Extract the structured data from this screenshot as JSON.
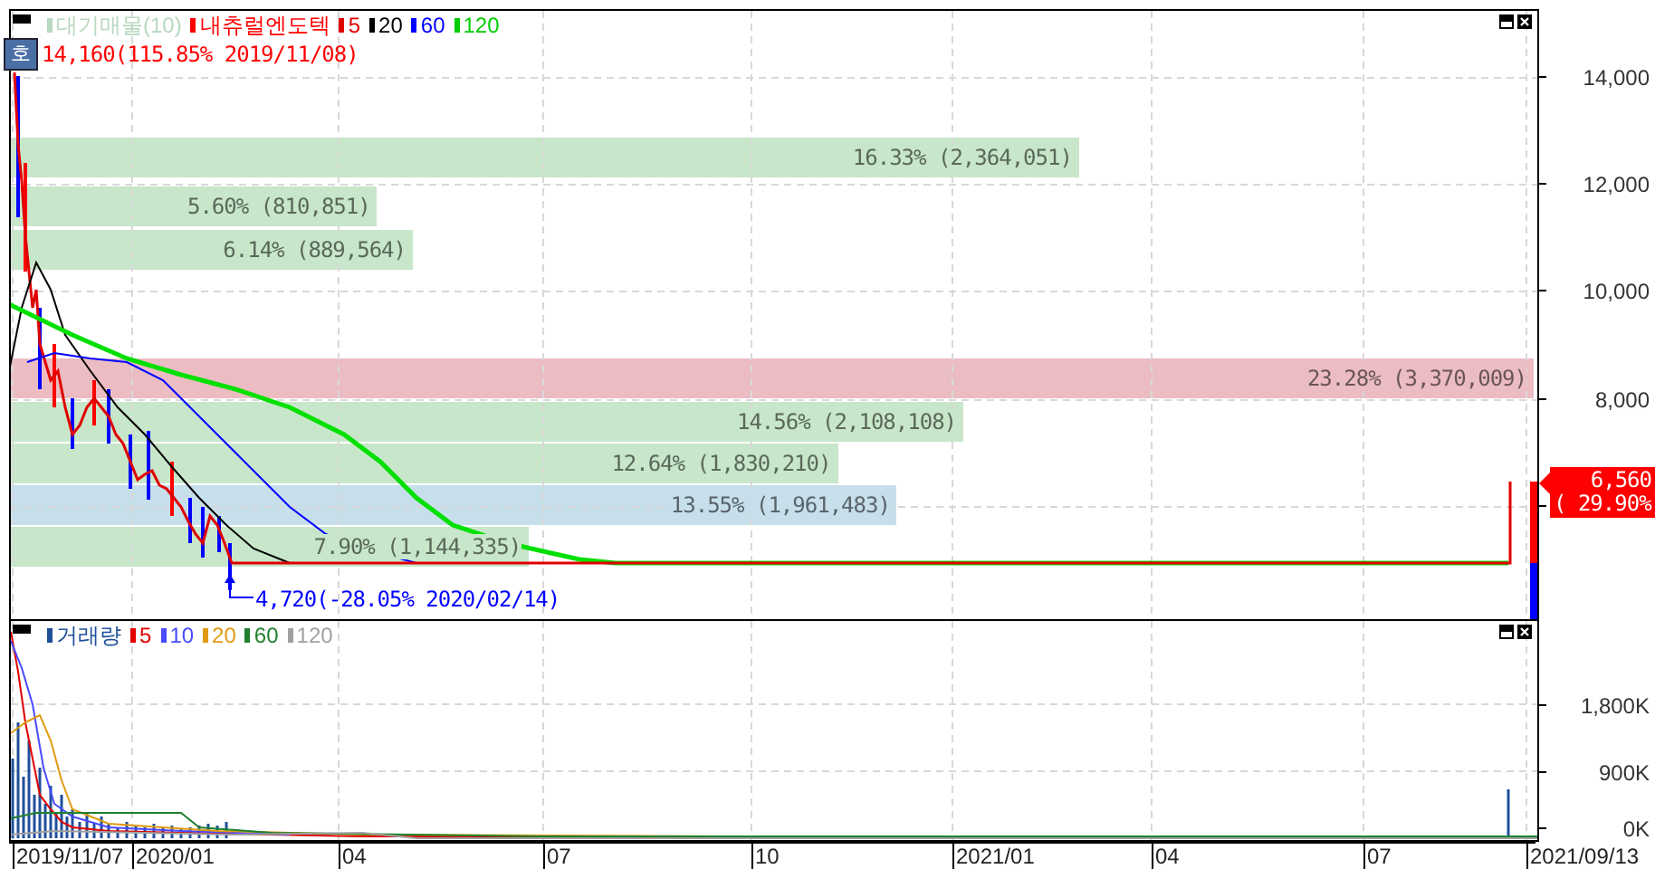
{
  "price_panel": {
    "legend": [
      {
        "label": "대기매물(10)",
        "color": "#b8d8c0"
      },
      {
        "label": "내츄럴엔도텍",
        "color": "#ff0000"
      },
      {
        "label": "5",
        "color": "#e00000"
      },
      {
        "label": "20",
        "color": "#000000"
      },
      {
        "label": "60",
        "color": "#0000ff"
      },
      {
        "label": "120",
        "color": "#00cc00"
      }
    ],
    "badge": "호",
    "high_label": "14,160(115.85% 2019/11/08)",
    "low_label": "4,720(-28.05% 2020/02/14)",
    "volume_profile": [
      {
        "label": "16.33% (2,364,051)",
        "level": 0.7015,
        "color": "#c8e6c9"
      },
      {
        "label": "5.60% (810,851)",
        "level": 0.2406,
        "color": "#c8e6c9"
      },
      {
        "label": "6.14% (889,564)",
        "level": 0.264,
        "color": "#c8e6c9"
      },
      {
        "label": "23.28% (3,370,009)",
        "level": 1,
        "color": "#ebbcc2"
      },
      {
        "label": "14.56% (2,108,108)",
        "level": 0.6255,
        "color": "#c8e6c9"
      },
      {
        "label": "12.64% (1,830,210)",
        "level": 0.5431,
        "color": "#c8e6c9"
      },
      {
        "label": "13.55% (1,961,483)",
        "level": 0.582,
        "color": "#c6dfeb"
      },
      {
        "label": "7.90% (1,144,335)",
        "level": 0.3396,
        "color": "#c8e6c9"
      }
    ],
    "y_axis": [
      "14,000",
      "12,000",
      "10,000",
      "8,000"
    ],
    "current_price": {
      "price": "6,560",
      "change": "( 29.90%)"
    }
  },
  "volume_panel": {
    "legend": [
      {
        "label": "거래량",
        "color": "#1f4e9a"
      },
      {
        "label": "5",
        "color": "#e00000"
      },
      {
        "label": "10",
        "color": "#4a4aff"
      },
      {
        "label": "20",
        "color": "#e09a10"
      },
      {
        "label": "60",
        "color": "#208030"
      },
      {
        "label": "120",
        "color": "#a0a0a0"
      }
    ],
    "y_axis": [
      "1,800K",
      "900K",
      "0K"
    ]
  },
  "x_axis": [
    "2019/11/07",
    "2020/01",
    "04",
    "07",
    "10",
    "2021/01",
    "04",
    "07"
  ],
  "last_date": "2021/09/13"
}
